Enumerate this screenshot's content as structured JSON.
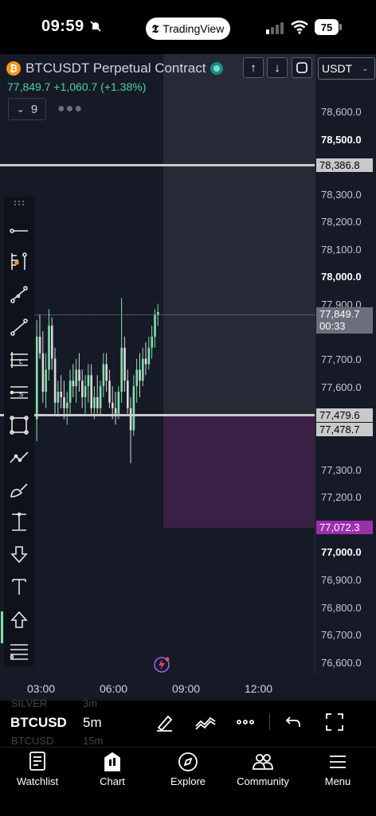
{
  "status_bar": {
    "time": "09:59",
    "app_pill": "TradingView",
    "battery": "75"
  },
  "header": {
    "symbol_title": "BTCUSDT Perpetual Contract",
    "coin_glyph": "₿",
    "currency": "USDT",
    "price": "77,849.7",
    "change": "+1,060.7",
    "change_pct": "(+1.38%)",
    "indicator_count": "9"
  },
  "price_scale": {
    "ticks": [
      {
        "label": "78,600.0",
        "bold": false
      },
      {
        "label": "78,500.0",
        "bold": true
      },
      {
        "label": "78,300.0",
        "bold": false
      },
      {
        "label": "78,200.0",
        "bold": false
      },
      {
        "label": "78,100.0",
        "bold": false
      },
      {
        "label": "78,000.0",
        "bold": true
      },
      {
        "label": "77,900.0",
        "bold": false
      },
      {
        "label": "77,700.0",
        "bold": false
      },
      {
        "label": "77,600.0",
        "bold": false
      },
      {
        "label": "77,300.0",
        "bold": false
      },
      {
        "label": "77,200.0",
        "bold": false
      },
      {
        "label": "77,000.0",
        "bold": true
      },
      {
        "label": "76,900.0",
        "bold": false
      },
      {
        "label": "76,800.0",
        "bold": false
      },
      {
        "label": "76,700.0",
        "bold": false
      },
      {
        "label": "76,600.0",
        "bold": false
      }
    ],
    "hline_upper": "78,386.8",
    "last_price": "77,849.7",
    "countdown": "00:33",
    "hline_lower": "77,479.6",
    "hline_lower_b": "77,478.7",
    "zone_bottom": "77,072.3",
    "colors": {
      "zone_label": "#9b2fae",
      "last_label": "#6b6f7b"
    }
  },
  "time_axis": {
    "labels": [
      "03:00",
      "06:00",
      "09:00",
      "12:00"
    ]
  },
  "toolbar": {
    "tools": [
      "crosshair-line-icon",
      "fib-icon",
      "trend-icon",
      "ray-icon",
      "long-position-icon",
      "short-position-icon",
      "rectangle-icon",
      "path-icon",
      "brush-icon",
      "measure-icon",
      "arrow-down-icon",
      "text-icon",
      "arrow-up-icon",
      "more-lines-icon"
    ]
  },
  "symbol_bar": {
    "symbol": "BTCUSD",
    "interval": "5m",
    "ghost_top_symbol": "SILVER",
    "ghost_top_interval": "3m",
    "ghost_bottom_symbol": "BTCUSD",
    "ghost_bottom_interval": "15m"
  },
  "nav": {
    "items": [
      {
        "label": "Watchlist",
        "icon": "watchlist-icon"
      },
      {
        "label": "Chart",
        "icon": "chart-icon"
      },
      {
        "label": "Explore",
        "icon": "compass-icon"
      },
      {
        "label": "Community",
        "icon": "community-icon"
      },
      {
        "label": "Menu",
        "icon": "menu-icon"
      }
    ]
  },
  "chart_data": {
    "type": "candlestick",
    "symbol": "BTCUSDT",
    "interval": "5m",
    "x_labels": [
      "03:00",
      "06:00",
      "09:00",
      "12:00"
    ],
    "last_price": 77849.7,
    "horizontal_lines": [
      78386.8,
      77479.6
    ],
    "ylim": [
      76550,
      78650
    ],
    "candles": [
      {
        "o": 77460,
        "h": 77820,
        "l": 77380,
        "c": 77760
      },
      {
        "o": 77760,
        "h": 77840,
        "l": 77680,
        "c": 77700
      },
      {
        "o": 77700,
        "h": 77780,
        "l": 77520,
        "c": 77560
      },
      {
        "o": 77560,
        "h": 77700,
        "l": 77500,
        "c": 77640
      },
      {
        "o": 77640,
        "h": 77860,
        "l": 77600,
        "c": 77800
      },
      {
        "o": 77800,
        "h": 77830,
        "l": 77640,
        "c": 77680
      },
      {
        "o": 77680,
        "h": 77720,
        "l": 77480,
        "c": 77520
      },
      {
        "o": 77520,
        "h": 77600,
        "l": 77470,
        "c": 77560
      },
      {
        "o": 77560,
        "h": 77620,
        "l": 77500,
        "c": 77540
      },
      {
        "o": 77540,
        "h": 77600,
        "l": 77460,
        "c": 77500
      },
      {
        "o": 77500,
        "h": 77560,
        "l": 77440,
        "c": 77520
      },
      {
        "o": 77520,
        "h": 77640,
        "l": 77480,
        "c": 77600
      },
      {
        "o": 77600,
        "h": 77660,
        "l": 77540,
        "c": 77580
      },
      {
        "o": 77580,
        "h": 77680,
        "l": 77520,
        "c": 77640
      },
      {
        "o": 77640,
        "h": 77700,
        "l": 77560,
        "c": 77600
      },
      {
        "o": 77600,
        "h": 77640,
        "l": 77500,
        "c": 77540
      },
      {
        "o": 77540,
        "h": 77620,
        "l": 77480,
        "c": 77580
      },
      {
        "o": 77580,
        "h": 77660,
        "l": 77520,
        "c": 77620
      },
      {
        "o": 77620,
        "h": 77660,
        "l": 77480,
        "c": 77500
      },
      {
        "o": 77500,
        "h": 77580,
        "l": 77460,
        "c": 77540
      },
      {
        "o": 77540,
        "h": 77620,
        "l": 77480,
        "c": 77500
      },
      {
        "o": 77500,
        "h": 77600,
        "l": 77470,
        "c": 77580
      },
      {
        "o": 77580,
        "h": 77700,
        "l": 77540,
        "c": 77660
      },
      {
        "o": 77660,
        "h": 77700,
        "l": 77560,
        "c": 77600
      },
      {
        "o": 77600,
        "h": 77640,
        "l": 77500,
        "c": 77520
      },
      {
        "o": 77520,
        "h": 77580,
        "l": 77460,
        "c": 77500
      },
      {
        "o": 77500,
        "h": 77560,
        "l": 77440,
        "c": 77480
      },
      {
        "o": 77480,
        "h": 77580,
        "l": 77460,
        "c": 77560
      },
      {
        "o": 77560,
        "h": 77900,
        "l": 77520,
        "c": 77720
      },
      {
        "o": 77720,
        "h": 77760,
        "l": 77560,
        "c": 77600
      },
      {
        "o": 77600,
        "h": 77640,
        "l": 77480,
        "c": 77500
      },
      {
        "o": 77500,
        "h": 77540,
        "l": 77300,
        "c": 77420
      },
      {
        "o": 77420,
        "h": 77620,
        "l": 77400,
        "c": 77580
      },
      {
        "o": 77580,
        "h": 77680,
        "l": 77520,
        "c": 77640
      },
      {
        "o": 77640,
        "h": 77700,
        "l": 77540,
        "c": 77600
      },
      {
        "o": 77600,
        "h": 77720,
        "l": 77580,
        "c": 77680
      },
      {
        "o": 77680,
        "h": 77740,
        "l": 77620,
        "c": 77660
      },
      {
        "o": 77660,
        "h": 77760,
        "l": 77640,
        "c": 77720
      },
      {
        "o": 77720,
        "h": 77800,
        "l": 77680,
        "c": 77760
      },
      {
        "o": 77760,
        "h": 77860,
        "l": 77720,
        "c": 77840
      },
      {
        "o": 77840,
        "h": 77880,
        "l": 77800,
        "c": 77850
      }
    ]
  }
}
